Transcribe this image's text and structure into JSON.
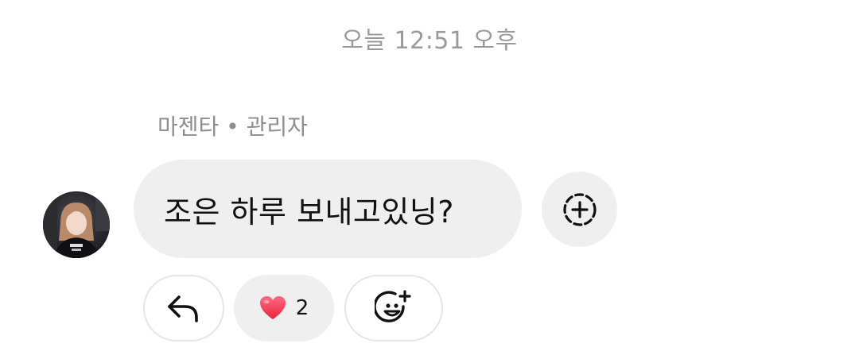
{
  "timestamp": "오늘 12:51 오후",
  "message": {
    "sender_label": "마젠타 • 관리자",
    "text": "조은 하루 보내고있닝?"
  },
  "reactions": {
    "reply_icon": "reply-arrow-icon",
    "heart_icon": "heart-emoji-icon",
    "heart_count": "2",
    "add_emoji_icon": "add-emoji-icon",
    "add_reaction_icon": "add-reaction-icon"
  },
  "colors": {
    "bubble": "#efefef",
    "heart": "#f0455e",
    "muted_text": "#9a9a9a"
  }
}
